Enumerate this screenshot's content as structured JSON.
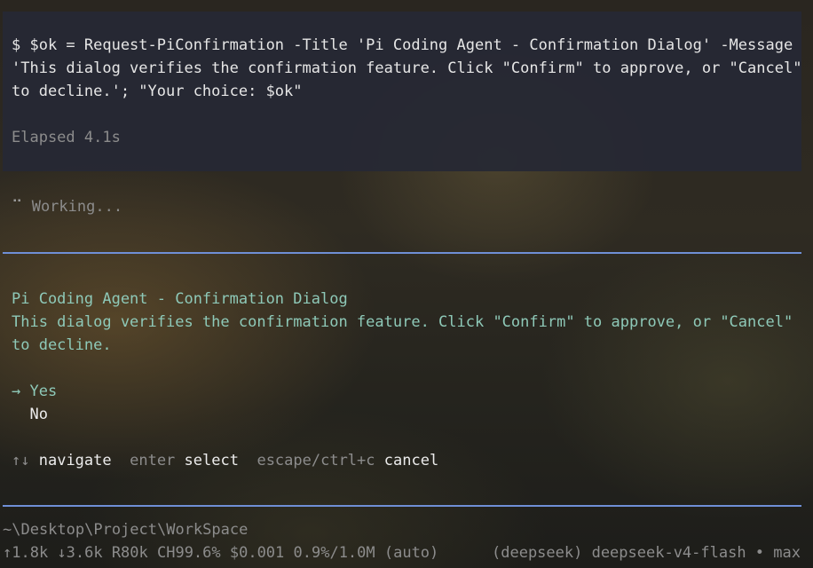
{
  "command_block": {
    "line1": "$ $ok = Request-PiConfirmation -Title 'Pi Coding Agent - Confirmation Dialog' -Message",
    "line2": "'This dialog verifies the confirmation feature. Click \"Confirm\" to approve, or \"Cancel\"",
    "line3": "to decline.'; \"Your choice: $ok\"",
    "elapsed": "Elapsed 4.1s"
  },
  "status": {
    "spinner": "⠉",
    "text": "Working..."
  },
  "dialog": {
    "title": "Pi Coding Agent - Confirmation Dialog",
    "message_line1": "This dialog verifies the confirmation feature. Click \"Confirm\" to approve, or \"Cancel\"",
    "message_line2": "to decline.",
    "options": [
      {
        "label": "Yes",
        "selected": true,
        "marker": "→"
      },
      {
        "label": "No",
        "selected": false,
        "marker": ""
      }
    ],
    "hints": {
      "nav_keys": "↑↓",
      "nav_action": "navigate",
      "select_keys": "enter",
      "select_action": "select",
      "cancel_keys": "escape/ctrl+c",
      "cancel_action": "cancel"
    }
  },
  "footer": {
    "path": "~\\Desktop\\Project\\WorkSpace",
    "stats": "↑1.8k ↓3.6k R80k CH99.6% $0.001 0.9%/1.0M (auto)",
    "model": "(deepseek) deepseek-v4-flash • max"
  },
  "colors": {
    "rule": "#6f8fd6",
    "accent_teal": "#8ec9b8",
    "command_bg": "#262834"
  }
}
